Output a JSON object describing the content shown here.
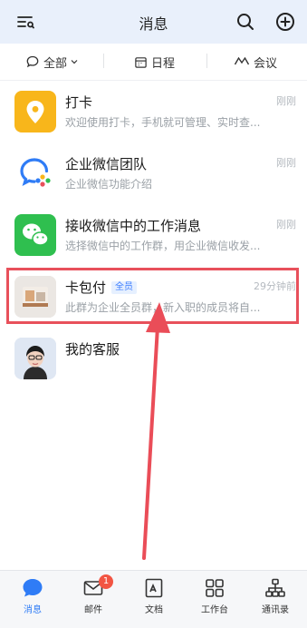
{
  "header": {
    "title": "消息"
  },
  "filters": {
    "all": "全部",
    "schedule": "日程",
    "meeting": "会议"
  },
  "conversations": [
    {
      "title": "打卡",
      "subtitle": "欢迎使用打卡，手机就可管理、实时查...",
      "time": "刚刚",
      "icon": "location-pin-icon",
      "color": "#f8b61b"
    },
    {
      "title": "企业微信团队",
      "subtitle": "企业微信功能介绍",
      "time": "刚刚",
      "icon": "wecom-logo-icon"
    },
    {
      "title": "接收微信中的工作消息",
      "subtitle": "选择微信中的工作群，用企业微信收发...",
      "time": "刚刚",
      "icon": "wechat-bubbles-icon",
      "color": "#2fbf4f"
    },
    {
      "title": "卡包付",
      "tag": "全员",
      "subtitle": "此群为企业全员群，新入职的成员将自...",
      "time": "29分钟前",
      "icon": "group-photo-avatar"
    },
    {
      "title": "我的客服",
      "subtitle": "",
      "time": "",
      "icon": "person-photo-avatar"
    }
  ],
  "tabbar": {
    "messages": "消息",
    "mail": "邮件",
    "mail_badge": "1",
    "docs": "文档",
    "workbench": "工作台",
    "contacts": "通讯录",
    "active_color": "#2f7cf6"
  }
}
